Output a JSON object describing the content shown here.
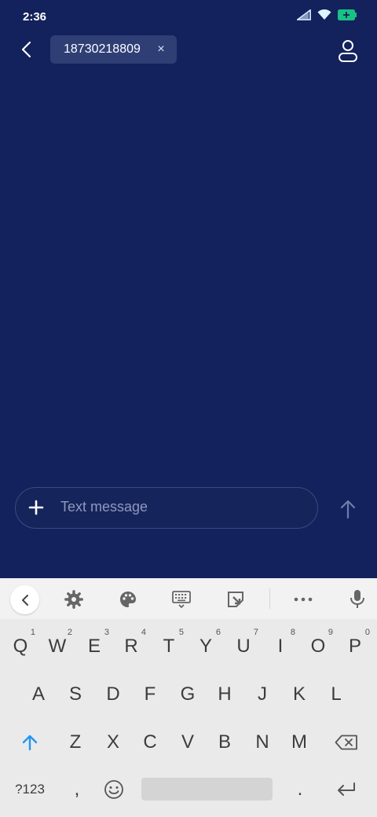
{
  "status_bar": {
    "time": "2:36",
    "battery_color": "#19c184"
  },
  "header": {
    "back_icon": "chevron-left-icon",
    "recipient": "18730218809",
    "recipient_close_glyph": "×",
    "contact_icon": "person-outline-icon"
  },
  "composer": {
    "add_icon": "plus-icon",
    "placeholder": "Text message",
    "send_icon": "arrow-up-icon"
  },
  "colors": {
    "background": "#13225c",
    "chip": "#2f3f75",
    "keyboard": "#eaeaea",
    "shift_accent": "#2196f3"
  },
  "keyboard": {
    "toolbar": [
      "chevron-left-icon",
      "settings-gear-icon",
      "palette-icon",
      "keyboard-icon",
      "clipboard-icon",
      "more-dots-icon",
      "microphone-icon"
    ],
    "row1": [
      {
        "key": "Q",
        "hint": "1"
      },
      {
        "key": "W",
        "hint": "2"
      },
      {
        "key": "E",
        "hint": "3"
      },
      {
        "key": "R",
        "hint": "4"
      },
      {
        "key": "T",
        "hint": "5"
      },
      {
        "key": "Y",
        "hint": "6"
      },
      {
        "key": "U",
        "hint": "7"
      },
      {
        "key": "I",
        "hint": "8"
      },
      {
        "key": "O",
        "hint": "9"
      },
      {
        "key": "P",
        "hint": "0"
      }
    ],
    "row2": [
      "A",
      "S",
      "D",
      "F",
      "G",
      "H",
      "J",
      "K",
      "L"
    ],
    "row3": [
      "Z",
      "X",
      "C",
      "V",
      "B",
      "N",
      "M"
    ],
    "row4": {
      "symbols": "?123",
      "comma": ",",
      "period": "."
    }
  }
}
